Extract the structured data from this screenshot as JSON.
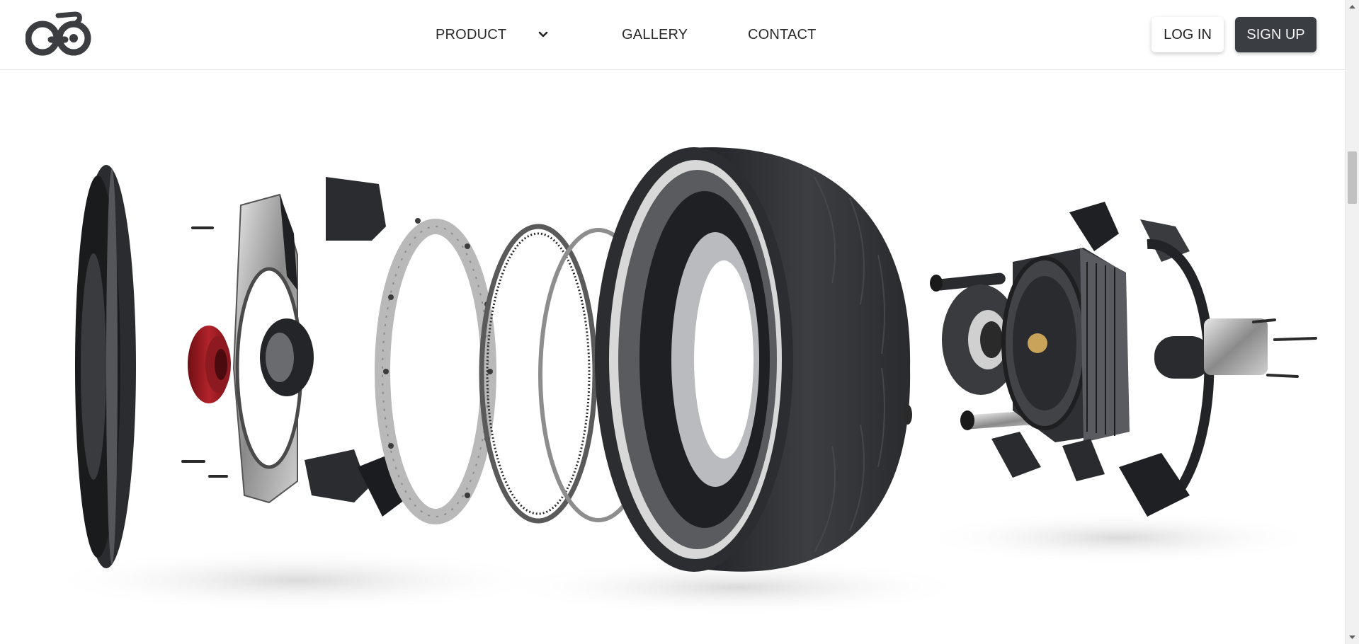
{
  "header": {
    "logo": {
      "icon": "bicycle-logo-icon"
    },
    "nav": {
      "product": "PRODUCT",
      "product_dropdown_icon": "chevron-down-icon",
      "gallery": "GALLERY",
      "contact": "CONTACT"
    },
    "auth": {
      "login_label": "LOG IN",
      "signup_label": "SIGN UP"
    }
  },
  "hero": {
    "image": "exploded-hub-motor-wheel-render",
    "components": [
      "side-cover-disc",
      "hub-frame-bracket",
      "red-hub-nut",
      "perforated-rotor-ring",
      "ring-gear",
      "retaining-ring",
      "tire-wheel",
      "motor-assembly"
    ]
  },
  "colors": {
    "accent_dark": "#3a3d42",
    "tire": "#2f3033",
    "hub_nut": "#9b1b22",
    "text": "#2a2a2a"
  },
  "scrollbar": {
    "icons": [
      "scroll-up-arrow-icon",
      "scroll-down-arrow-icon"
    ]
  }
}
